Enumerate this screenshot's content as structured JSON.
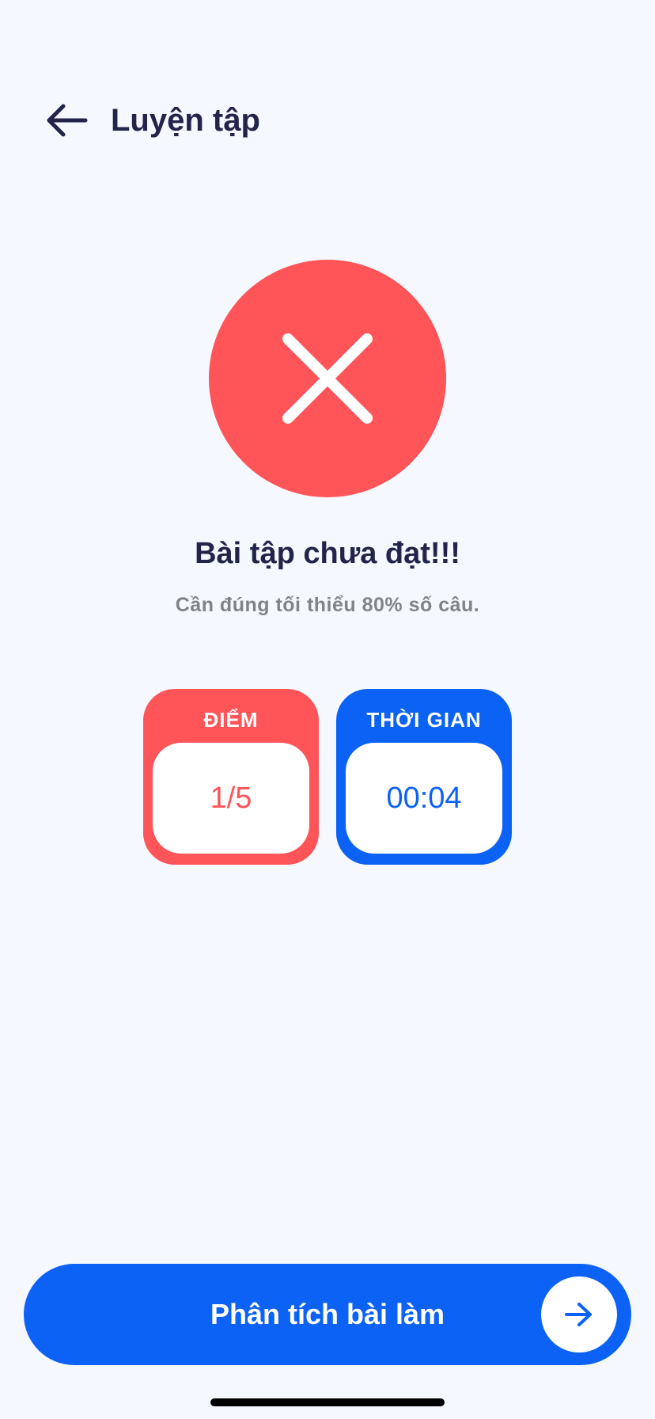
{
  "header": {
    "back_icon": "arrow-left-icon",
    "title": "Luyện tập"
  },
  "result": {
    "icon": "close-icon",
    "status_color": "#ff5458",
    "title": "Bài tập chưa đạt!!!",
    "subtitle": "Cần đúng tối thiểu 80% số câu."
  },
  "stats": {
    "score": {
      "label": "ĐIỂM",
      "value": "1/5",
      "color": "#ff5458"
    },
    "time": {
      "label": "THỜI GIAN",
      "value": "00:04",
      "color": "#0b62f5"
    }
  },
  "action": {
    "label": "Phân tích bài làm",
    "icon": "arrow-right-icon",
    "color": "#0b62f5"
  }
}
